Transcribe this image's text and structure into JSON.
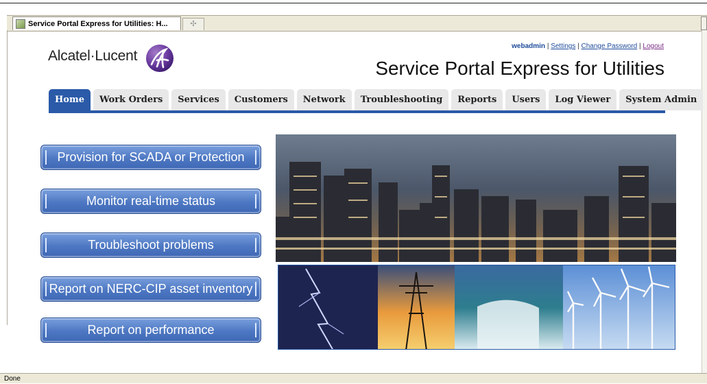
{
  "browser": {
    "tab_title": "Service Portal Express for Utilities: H...",
    "new_tab_glyph": "✣",
    "status": "Done"
  },
  "header": {
    "logo_text": "Alcatel·Lucent",
    "username": "webadmin",
    "sep": "|",
    "links": [
      "Settings",
      "Change Password",
      "Logout"
    ],
    "title": "Service Portal Express for Utilities"
  },
  "nav": {
    "tabs": [
      "Home",
      "Work Orders",
      "Services",
      "Customers",
      "Network",
      "Troubleshooting",
      "Reports",
      "Users",
      "Log Viewer",
      "System Admin"
    ],
    "active": "Home"
  },
  "actions": [
    "Provision for SCADA or Protection",
    "Monitor real-time status",
    "Troubleshoot problems",
    "Report on NERC-CIP asset inventory",
    "Report on performance"
  ],
  "images": {
    "hero": "city-skyline-night-image",
    "strip": [
      "lightning-image",
      "power-tower-sunset-image",
      "waterfall-image",
      "wind-turbines-image"
    ]
  },
  "colors": {
    "brand_blue": "#2a5aa8",
    "button_blue": "#4d77c2",
    "link_blue": "#1f4c9a"
  }
}
